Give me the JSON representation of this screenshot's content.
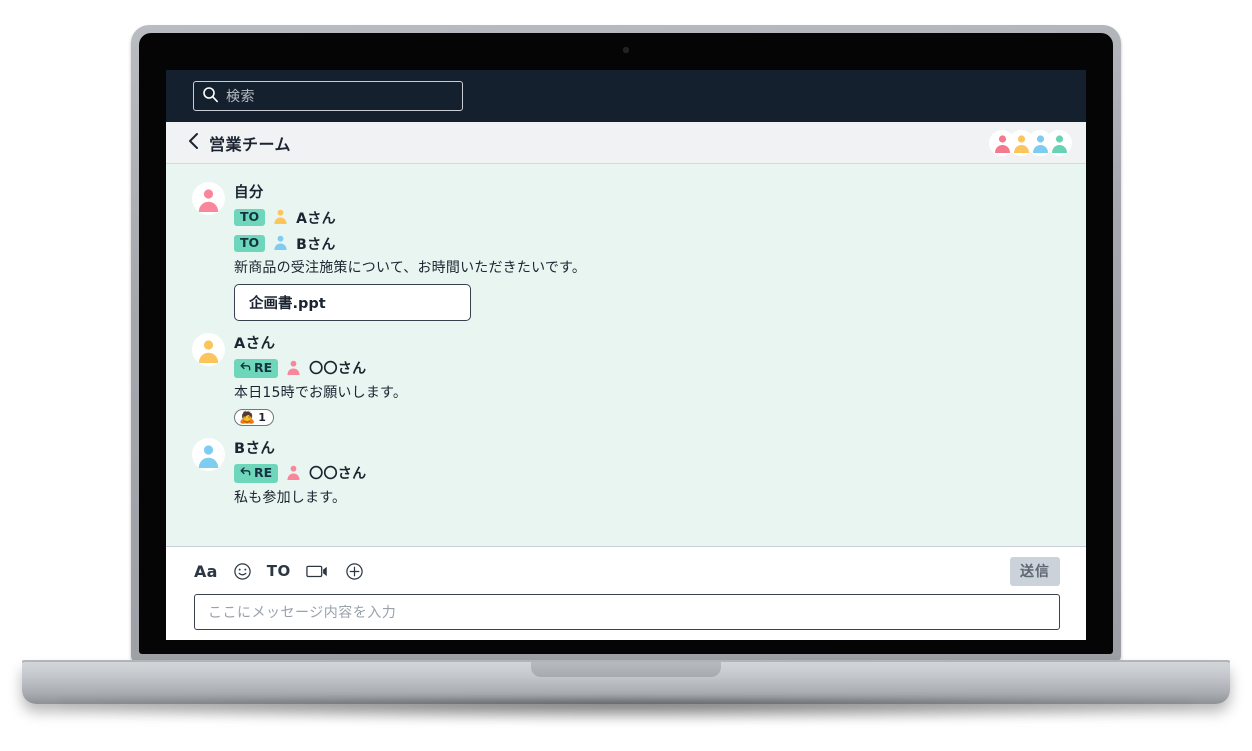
{
  "search": {
    "placeholder": "検索",
    "icon": "search-icon"
  },
  "header": {
    "back_icon": "chevron-left-icon",
    "title": "営業チーム",
    "members": [
      {
        "icon": "person-icon",
        "color": "#f4798f"
      },
      {
        "icon": "person-icon",
        "color": "#fbc55c"
      },
      {
        "icon": "person-icon",
        "color": "#7ecdf0"
      },
      {
        "icon": "person-icon",
        "color": "#68d3b4"
      }
    ]
  },
  "messages": [
    {
      "sender": "自分",
      "avatar_icon": "person-icon",
      "avatar_color": "#f9879b",
      "recipients": [
        {
          "badge": "TO",
          "badge_icon": "",
          "name": "Aさん",
          "person_color": "#fbc55c"
        },
        {
          "badge": "TO",
          "badge_icon": "",
          "name": "Bさん",
          "person_color": "#7ecdf0"
        }
      ],
      "text": "新商品の受注施策について、お時間いただきたいです。",
      "attachment": "企画書.ppt",
      "reaction": null
    },
    {
      "sender": "Aさん",
      "avatar_icon": "person-icon",
      "avatar_color": "#fbc55c",
      "recipients": [
        {
          "badge": "RE",
          "badge_icon": "reply-arrow-icon",
          "name": "〇〇さん",
          "person_color": "#f9879b"
        }
      ],
      "text": "本日15時でお願いします。",
      "attachment": null,
      "reaction": {
        "emoji": "🙇",
        "count": "1"
      }
    },
    {
      "sender": "Bさん",
      "avatar_icon": "person-icon",
      "avatar_color": "#7ecdf0",
      "recipients": [
        {
          "badge": "RE",
          "badge_icon": "reply-arrow-icon",
          "name": "〇〇さん",
          "person_color": "#f9879b"
        }
      ],
      "text": "私も参加します。",
      "attachment": null,
      "reaction": null
    }
  ],
  "composer": {
    "tools": [
      {
        "name": "text-format",
        "label": "Aa"
      },
      {
        "name": "emoji",
        "label": ""
      },
      {
        "name": "to",
        "label": "TO"
      },
      {
        "name": "video",
        "label": ""
      },
      {
        "name": "add",
        "label": ""
      }
    ],
    "send_label": "送信",
    "placeholder": "ここにメッセージ内容を入力"
  },
  "colors": {
    "topbar": "#15202e",
    "header_bar": "#f1f2f4",
    "chat_bg": "#e9f5f1",
    "badge_teal": "#6ed7bb",
    "send_bg": "#ccd2d9"
  }
}
